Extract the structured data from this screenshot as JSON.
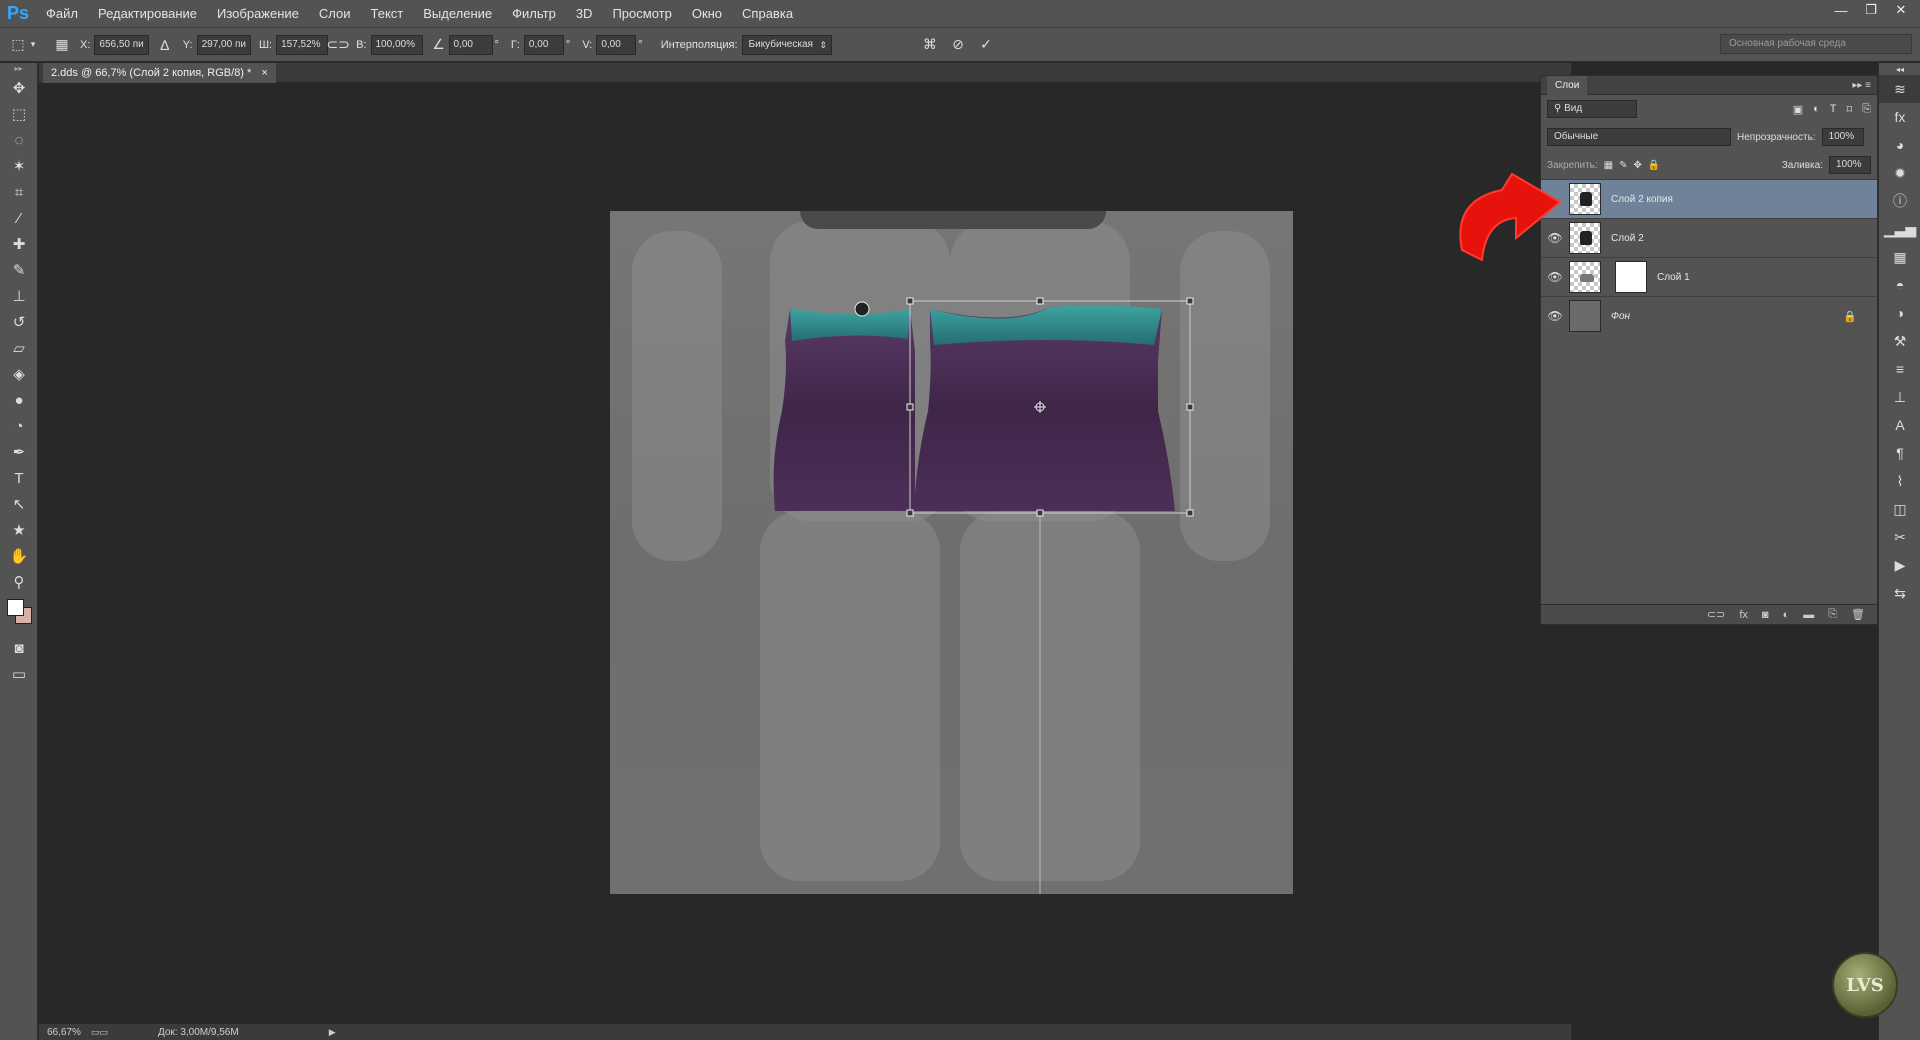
{
  "app": {
    "logo": "Ps"
  },
  "menu": [
    "Файл",
    "Редактирование",
    "Изображение",
    "Слои",
    "Текст",
    "Выделение",
    "Фильтр",
    "3D",
    "Просмотр",
    "Окно",
    "Справка"
  ],
  "window_controls": {
    "minimize": "—",
    "restore": "❐",
    "close": "✕"
  },
  "options": {
    "x_label": "X:",
    "x_value": "656,50 пи",
    "y_label": "Y:",
    "y_value": "297,00 пи",
    "w_label": "Ш:",
    "w_value": "157,52%",
    "h_label": "В:",
    "h_value": "100,00%",
    "angle_value": "0,00",
    "g_label": "Г:",
    "g_value": "0,00",
    "v_label": "V:",
    "v_value": "0,00",
    "interp_label": "Интерполяция:",
    "interp_value": "Бикубическая",
    "workspace": "Основная рабочая среда"
  },
  "document": {
    "tab_title": "2.dds @ 66,7% (Слой 2 копия, RGB/8) *",
    "close": "×"
  },
  "status": {
    "zoom": "66,67%",
    "doc": "Док: 3,00M/9,56M"
  },
  "layers_panel": {
    "tab": "Слои",
    "filter_kind": "Вид",
    "blend_mode": "Обычные",
    "opacity_label": "Непрозрачность:",
    "opacity_value": "100%",
    "lock_label": "Закрепить:",
    "fill_label": "Заливка:",
    "fill_value": "100%",
    "layers": [
      {
        "name": "Слой 2 копия",
        "selected": true
      },
      {
        "name": "Слой 2",
        "selected": false
      },
      {
        "name": "Слой 1",
        "selected": false
      },
      {
        "name": "Фон",
        "selected": false
      }
    ]
  },
  "watermark": "LVS",
  "colors": {
    "accent": "#31a8ff",
    "arrow": "#e8120c",
    "selected_layer": "#6f8299",
    "fg_color": "#ffffff",
    "bg_color": "#d8b0a8"
  }
}
